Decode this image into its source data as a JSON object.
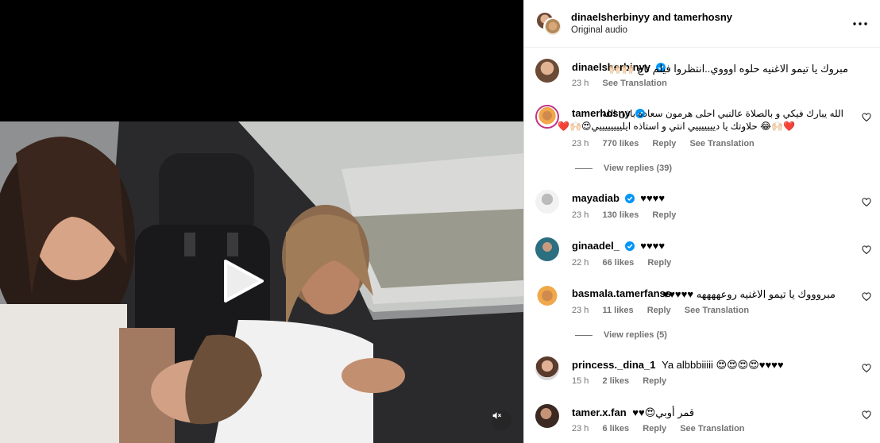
{
  "post": {
    "header": {
      "title": "dinaelsherbinyy and tamerhosny",
      "subtitle": "Original audio",
      "more_icon": "more-horizontal-icon"
    },
    "video": {
      "play_icon": "play-icon",
      "mute_icon": "muted-speaker-icon"
    }
  },
  "comments": [
    {
      "username": "dinaelsherbinyy",
      "verified": true,
      "text": "مبروك يا تيمو الاغنيه حلوه اوووي..انتظروا فيلم تاج 🙌🏻🙌🏻",
      "time": "23 h",
      "likes": "",
      "reply": "",
      "translate": "See Translation",
      "caption": true
    },
    {
      "username": "tamerhosny",
      "verified": true,
      "text": "الله يبارك فيكي و بالصلاة عالنبي احلى هرمون سعاده باذن الله",
      "text2": "❤️🙌🏻😂 حلاوتك يا ديييييييي انتي و استاذه ايلييييييييي😍🙌🏻❤️",
      "time": "23 h",
      "likes": "770 likes",
      "reply": "Reply",
      "translate": "See Translation",
      "view_replies": "View replies (39)"
    },
    {
      "username": "mayadiab",
      "verified": true,
      "text": "♥♥♥♥",
      "time": "23 h",
      "likes": "130 likes",
      "reply": "Reply",
      "translate": ""
    },
    {
      "username": "ginaadel_",
      "verified": true,
      "text": "♥♥♥♥",
      "time": "22 h",
      "likes": "66 likes",
      "reply": "Reply",
      "translate": ""
    },
    {
      "username": "basmala.tamerfanss",
      "verified": false,
      "text": "مبروووك يا تيمو الاغنيه روعههههه ♥♥♥♥♥",
      "time": "23 h",
      "likes": "11 likes",
      "reply": "Reply",
      "translate": "See Translation",
      "view_replies": "View replies (5)"
    },
    {
      "username": "princess._dina_1",
      "verified": false,
      "text": "Ya albbbiiiii 😍😍😍😍♥♥♥♥",
      "time": "15 h",
      "likes": "2 likes",
      "reply": "Reply",
      "translate": ""
    },
    {
      "username": "tamer.x.fan",
      "verified": false,
      "text": "♥♥😍قمر أوبي",
      "time": "23 h",
      "likes": "6 likes",
      "reply": "Reply",
      "translate": "See Translation"
    }
  ],
  "colors": {
    "verified_blue": "#0095f6",
    "meta_gray": "#737373",
    "divider": "#dbdbdb"
  }
}
